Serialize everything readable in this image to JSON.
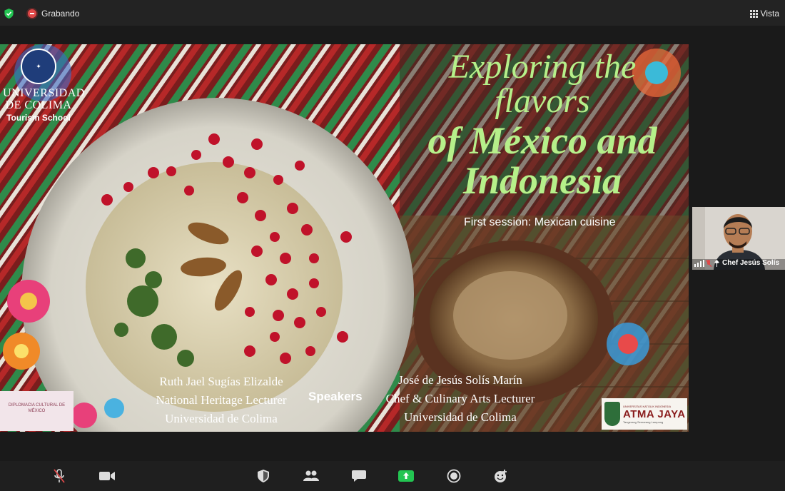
{
  "topbar": {
    "recording_label": "Grabando",
    "view_label": "Vista"
  },
  "slide": {
    "logo": {
      "name_line1": "UNIVERSIDAD",
      "name_line2": "DE COLIMA",
      "school": "Tourism School"
    },
    "title": {
      "line1": "Exploring the",
      "line2": "flavors",
      "line3": "of México and",
      "line4": "Indonesia"
    },
    "subtitle": "First session: Mexican cuisine",
    "speakers_label": "Speakers",
    "speaker_left": {
      "name": "Ruth Jael Sugías Elizalde",
      "role": "National Heritage Lecturer",
      "org": "Universidad de Colima"
    },
    "speaker_right": {
      "name": "José de Jesús Solís Marín",
      "role": "Chef & Culinary Arts Lecturer",
      "org": "Universidad de Colima"
    },
    "diplomacy_logo_text": "DIPLOMACIA CULTURAL DE MÉXICO",
    "atma_logo": {
      "top": "UNIVERSITAS KATOLIK INDONESIA",
      "main": "ATMA JAYA",
      "sub": "Tangerang Semarang Lampung"
    }
  },
  "participant_tile": {
    "name": "Chef Jesús Solís"
  },
  "toolbar_icons": [
    "mic-muted-icon",
    "video-icon",
    "security-icon",
    "participants-icon",
    "chat-icon",
    "share-screen-icon",
    "record-icon",
    "reactions-icon"
  ],
  "colors": {
    "title_green": "#b6f08a",
    "share_green": "#23c552",
    "record_red": "#e04848"
  }
}
